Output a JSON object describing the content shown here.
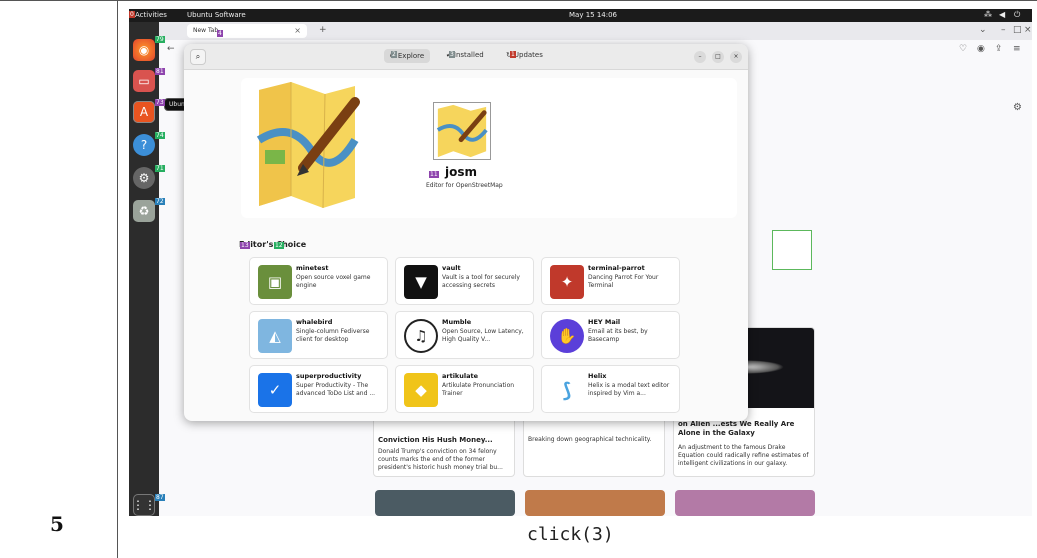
{
  "step": {
    "number": "5",
    "action": "click(3)"
  },
  "topbar": {
    "activities": "Activities",
    "app_menu": "Ubuntu Software",
    "clock": "May 15 14:06",
    "tray_icons": [
      "network-icon",
      "volume-icon",
      "power-icon"
    ]
  },
  "dock": {
    "tooltip": "Ubuntu Software",
    "items": [
      "firefox-icon",
      "files-icon",
      "ubuntu-software-icon",
      "help-icon",
      "settings-icon",
      "trash-icon",
      "show-apps-icon"
    ]
  },
  "browser": {
    "tab_title": "New Tab"
  },
  "software": {
    "tabs": [
      {
        "label": "Explore",
        "icon": "compass-icon",
        "active": true
      },
      {
        "label": "Installed",
        "icon": "check-icon",
        "active": false
      },
      {
        "label": "Updates",
        "icon": "refresh-icon",
        "active": false
      }
    ],
    "featured": {
      "name": "josm",
      "summary": "Editor for OpenStreetMap"
    },
    "section_title": "Editor's Choice",
    "apps": [
      {
        "name": "minetest",
        "desc": "Open source voxel game engine",
        "color": "#6a8f3c"
      },
      {
        "name": "vault",
        "desc": "Vault is a tool for securely accessing secrets",
        "color": "#111111"
      },
      {
        "name": "terminal-parrot",
        "desc": "Dancing Parrot For Your Terminal",
        "color": "#c0392b"
      },
      {
        "name": "whalebird",
        "desc": "Single-column Fediverse client for desktop",
        "color": "#7fb6e0"
      },
      {
        "name": "Mumble",
        "desc": "Open Source, Low Latency, High Quality V...",
        "color": "#222222"
      },
      {
        "name": "HEY Mail",
        "desc": "Email at its best, by Basecamp",
        "color": "#5b3fd9"
      },
      {
        "name": "superproductivity",
        "desc": "Super Productivity - The advanced ToDo List and ...",
        "color": "#1a73e8"
      },
      {
        "name": "artikulate",
        "desc": "Artikulate Pronunciation Trainer",
        "color": "#f0c419"
      },
      {
        "name": "Helix",
        "desc": "Helix is a modal text editor inspired by Vim a...",
        "color": "#4aa3df"
      }
    ]
  },
  "news": [
    {
      "title": "Conviction His Hush Money...",
      "text": "Donald Trump's conviction on 34 felony counts marks the end of the former president's historic hush money trial bu..."
    },
    {
      "title": "",
      "text": "Breaking down geographical technicality."
    },
    {
      "title": "on Alien ...ests We Really Are Alone in the Galaxy",
      "text": "An adjustment to the famous Drake Equation could radically refine estimates of intelligent civilizations in our galaxy."
    }
  ],
  "marks": {
    "activities": "0",
    "tab": "4",
    "explore": "2",
    "installed": "3",
    "updates": "1",
    "firefox": "79",
    "files": "81",
    "software": "73",
    "help": "74",
    "settings": "71",
    "trash": "72",
    "apps": "87",
    "featured_name": "11",
    "editors": "13",
    "choice": "12"
  }
}
